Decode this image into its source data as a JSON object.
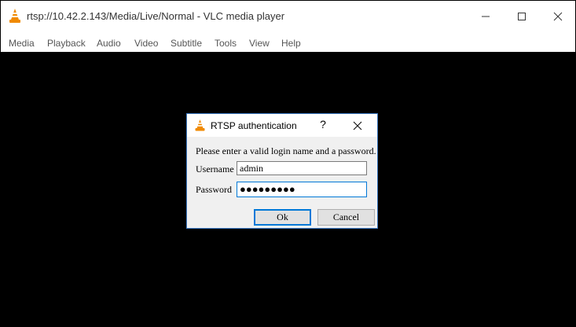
{
  "window": {
    "title": "rtsp://10.42.2.143/Media/Live/Normal - VLC media player",
    "icon": "vlc-cone-icon",
    "controls": [
      "minimize-icon",
      "maximize-icon",
      "close-icon"
    ]
  },
  "menubar": {
    "items": [
      "Media",
      "Playback",
      "Audio",
      "Video",
      "Subtitle",
      "Tools",
      "View",
      "Help"
    ]
  },
  "dialog": {
    "title": "RTSP authentication",
    "help": "?",
    "prompt": "Please enter a valid login name and a password.",
    "username_label": "Username",
    "username_value": "admin",
    "password_label": "Password",
    "password_value": "●●●●●●●●●",
    "ok_label": "Ok",
    "cancel_label": "Cancel"
  },
  "colors": {
    "video_background": "#000000",
    "focus_accent": "#0078d7",
    "dialog_border": "#3b79c4",
    "vlc_orange": "#f08a00"
  }
}
